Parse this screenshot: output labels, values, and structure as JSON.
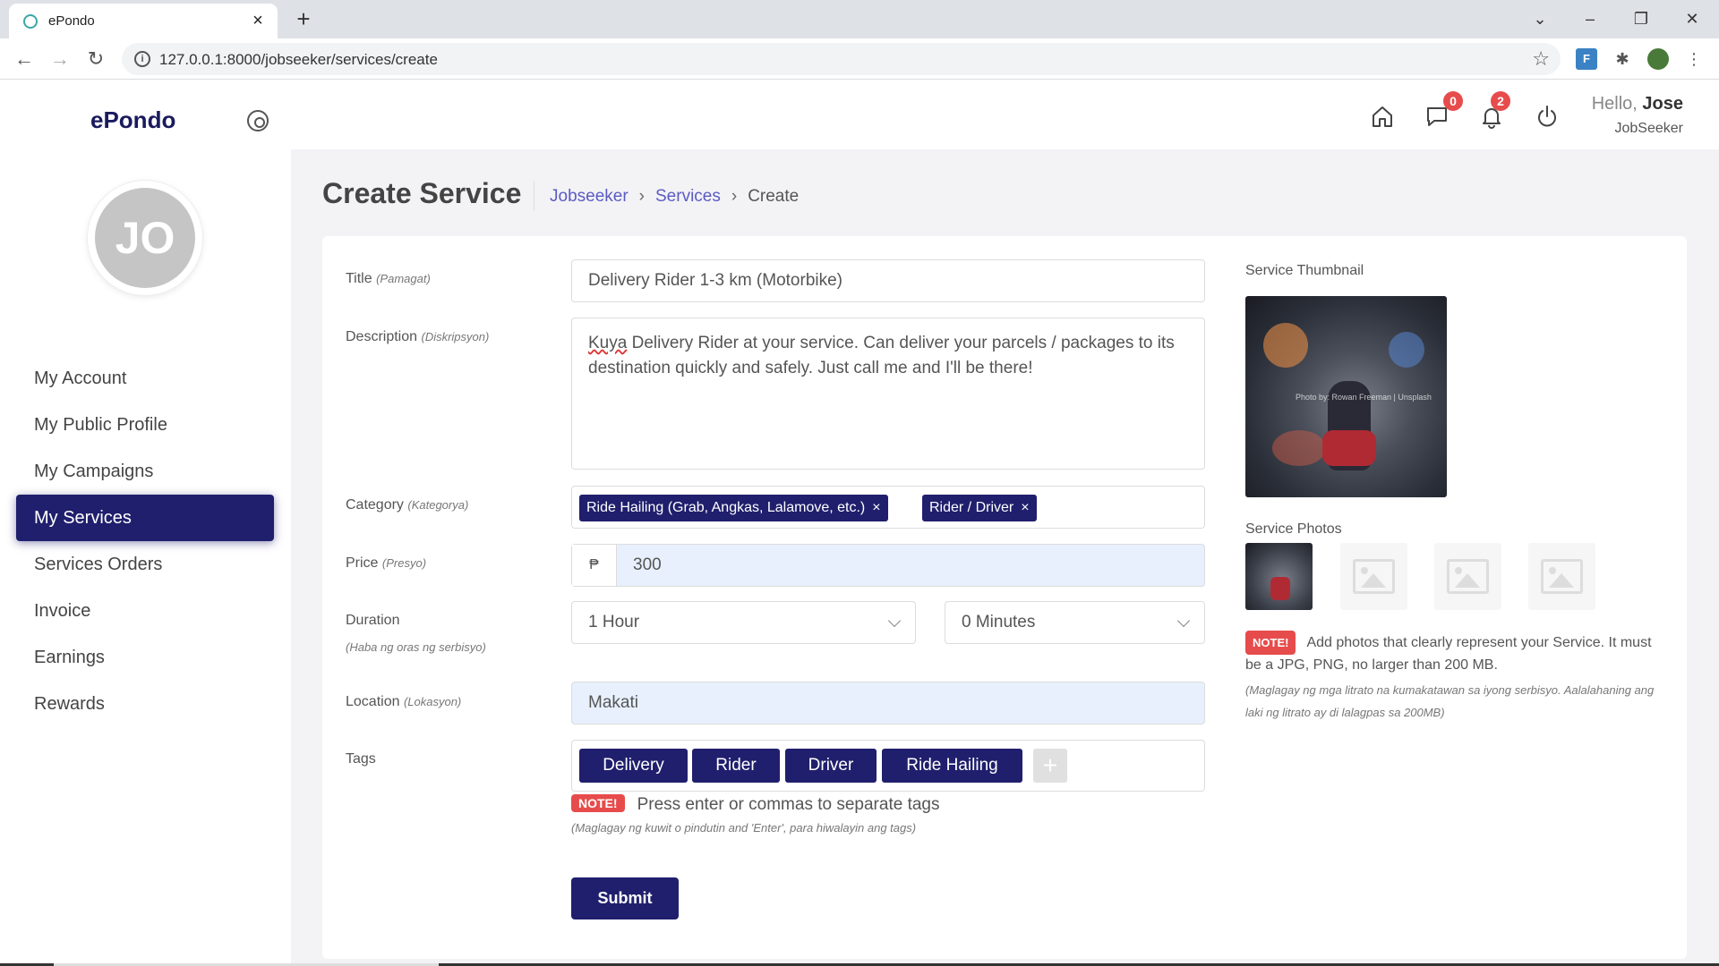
{
  "browser": {
    "tab_title": "ePondo",
    "url": "127.0.0.1:8000/jobseeker/services/create"
  },
  "sidebar": {
    "brand": "ePondo",
    "avatar_initials": "JO",
    "items": [
      {
        "label": "My Account"
      },
      {
        "label": "My Public Profile"
      },
      {
        "label": "My Campaigns"
      },
      {
        "label": "My Services",
        "active": true
      },
      {
        "label": "Services Orders"
      },
      {
        "label": "Invoice"
      },
      {
        "label": "Earnings"
      },
      {
        "label": "Rewards"
      }
    ]
  },
  "topbar": {
    "messages_count": "0",
    "notifications_count": "2",
    "hello": "Hello,",
    "user_name": "Jose",
    "role": "JobSeeker"
  },
  "header": {
    "title": "Create Service",
    "breadcrumb": [
      "Jobseeker",
      "Services",
      "Create"
    ]
  },
  "form": {
    "title": {
      "label": "Title",
      "label_hint": "(Pamagat)",
      "value": "Delivery Rider 1-3 km (Motorbike)"
    },
    "description": {
      "label": "Description",
      "label_hint": "(Diskripsyon)",
      "first_word": "Kuya",
      "value_rest": " Delivery Rider at your service. Can deliver your parcels / packages to its destination quickly and safely. Just call me and I'll be there!"
    },
    "category": {
      "label": "Category",
      "label_hint": "(Kategorya)",
      "chips": [
        "Ride Hailing (Grab, Angkas, Lalamove, etc.)",
        "Rider / Driver"
      ]
    },
    "price": {
      "label": "Price",
      "label_hint": "(Presyo)",
      "currency": "₱",
      "value": "300"
    },
    "duration": {
      "label": "Duration",
      "label_hint": "(Haba ng oras ng serbisyo)",
      "hours": "1 Hour",
      "minutes": "0 Minutes"
    },
    "location": {
      "label": "Location",
      "label_hint": "(Lokasyon)",
      "value": "Makati"
    },
    "tags": {
      "label": "Tags",
      "items": [
        "Delivery",
        "Rider",
        "Driver",
        "Ride Hailing"
      ],
      "add_symbol": "+",
      "note_badge": "NOTE!",
      "note_text": "Press enter or commas to separate tags",
      "note_hint": "(Maglagay ng kuwit o pindutin and 'Enter', para hiwalayin ang tags)"
    },
    "submit_label": "Submit"
  },
  "media": {
    "thumbnail_label": "Service Thumbnail",
    "thumbnail_watermark": "Photo by: Rowan Freeman | Unsplash",
    "photos_label": "Service Photos",
    "note_badge": "NOTE!",
    "note_text": "Add photos that clearly represent your Service. It must be a JPG, PNG, no larger than 200 MB.",
    "note_hint": "(Maglagay ng mga litrato na kumakatawan sa iyong serbisyo. Aalalahaning ang laki ng litrato ay di lalagpas sa 200MB)"
  },
  "colors": {
    "primary": "#201f6d",
    "accent_link": "#5b5bc2",
    "badge_red": "#e74c4c"
  }
}
